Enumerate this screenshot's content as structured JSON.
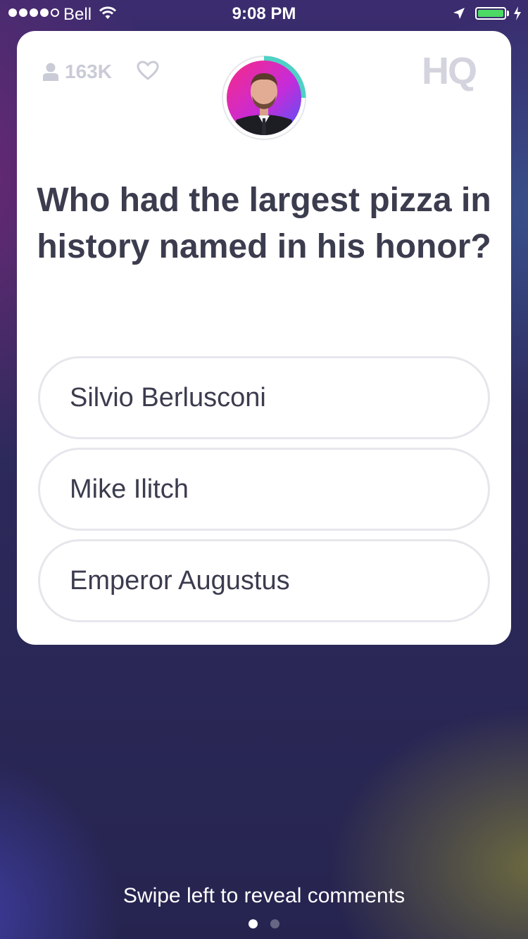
{
  "status_bar": {
    "carrier": "Bell",
    "time": "9:08 PM",
    "battery_level": 1.0,
    "charging": true
  },
  "card": {
    "viewer_count": "163K",
    "logo": "HQ",
    "timer_progress": 0.25,
    "question": "Who had the largest pizza in history named in his honor?",
    "answers": [
      {
        "label": "Silvio Berlusconi"
      },
      {
        "label": "Mike Ilitch"
      },
      {
        "label": "Emperor Augustus"
      }
    ]
  },
  "footer": {
    "hint": "Swipe left to reveal comments",
    "pages": 2,
    "active_page": 1
  },
  "colors": {
    "card_text": "#3b3c4e",
    "muted": "#c9cbd6",
    "answer_border": "#e6e6ec",
    "timer_ring": "#4fd1c5",
    "battery": "#4cd964"
  },
  "icons": [
    "signal-dots-icon",
    "wifi-icon",
    "location-arrow-icon",
    "battery-icon",
    "charging-bolt-icon",
    "person-icon",
    "heart-icon"
  ]
}
